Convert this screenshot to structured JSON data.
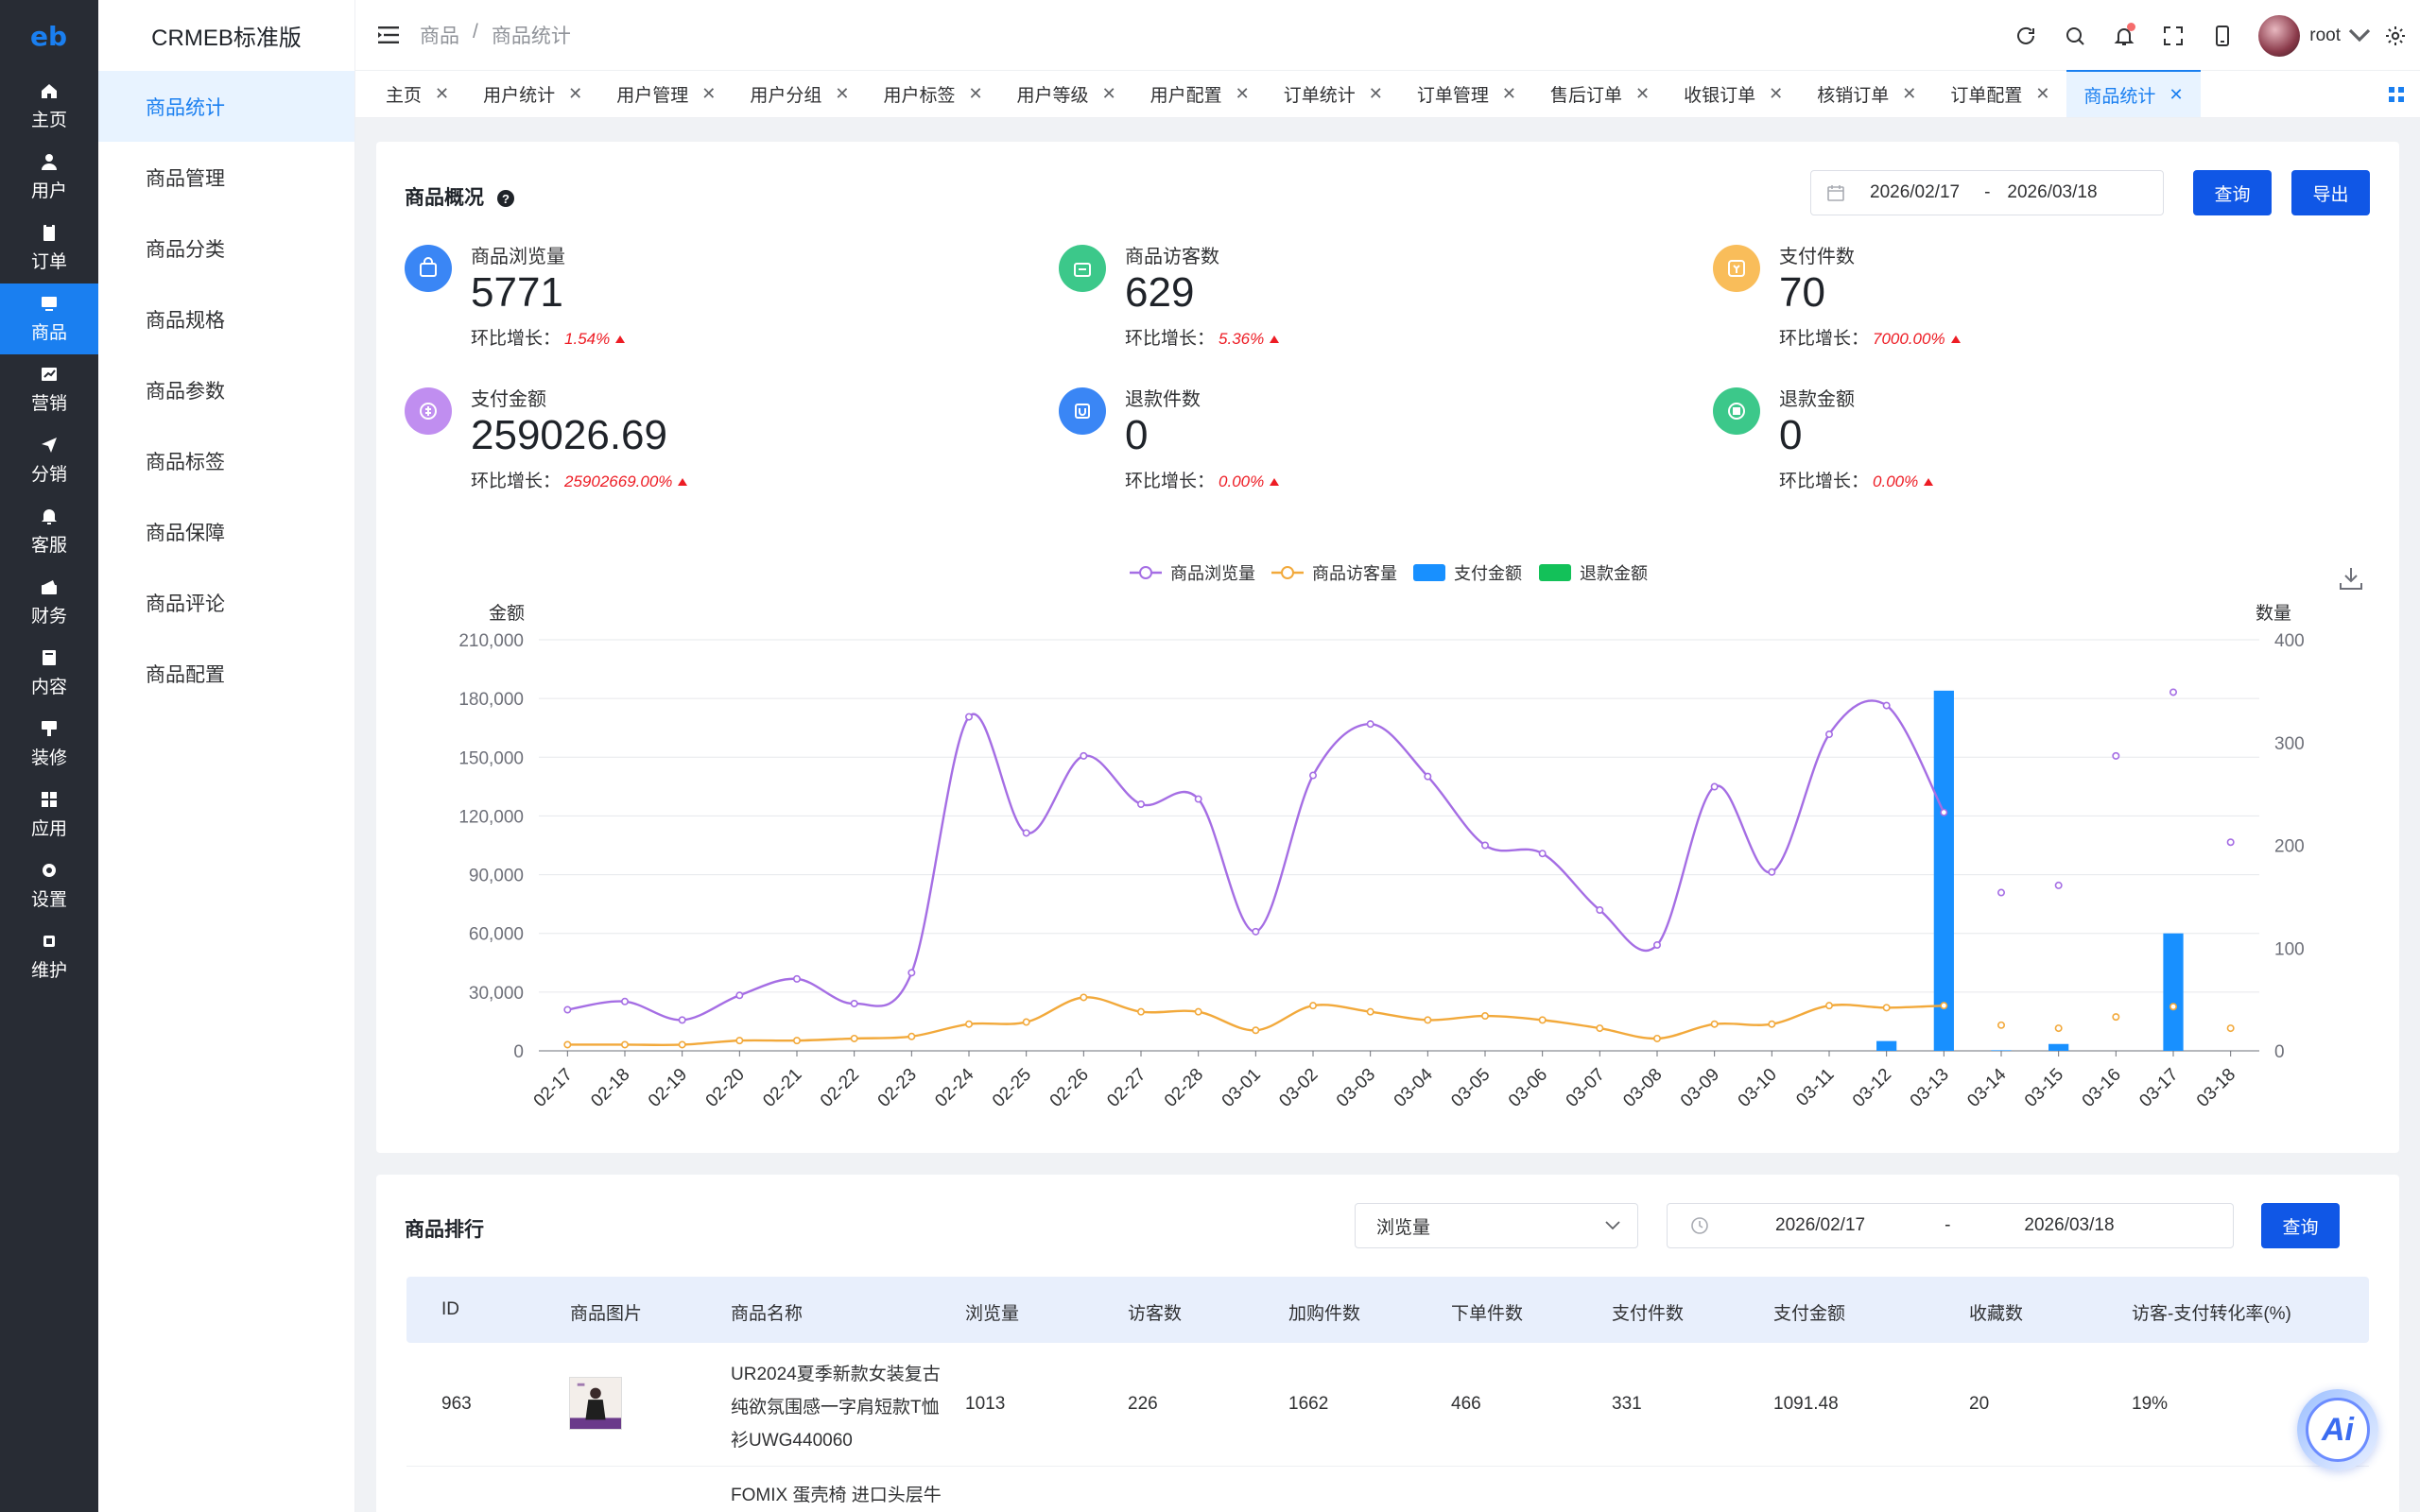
{
  "rail": {
    "logo": "eb",
    "items": [
      {
        "label": "主页",
        "icon": "home-icon"
      },
      {
        "label": "用户",
        "icon": "user-icon"
      },
      {
        "label": "订单",
        "icon": "order-icon"
      },
      {
        "label": "商品",
        "icon": "product-icon"
      },
      {
        "label": "营销",
        "icon": "marketing-icon"
      },
      {
        "label": "分销",
        "icon": "distribution-icon"
      },
      {
        "label": "客服",
        "icon": "service-icon"
      },
      {
        "label": "财务",
        "icon": "finance-icon"
      },
      {
        "label": "内容",
        "icon": "content-icon"
      },
      {
        "label": "装修",
        "icon": "decorate-icon"
      },
      {
        "label": "应用",
        "icon": "apps-icon"
      },
      {
        "label": "设置",
        "icon": "settings-icon"
      },
      {
        "label": "维护",
        "icon": "maintain-icon"
      }
    ],
    "active_index": 3
  },
  "submenu": {
    "brand": "CRMEB标准版",
    "items": [
      "商品统计",
      "商品管理",
      "商品分类",
      "商品规格",
      "商品参数",
      "商品标签",
      "商品保障",
      "商品评论",
      "商品配置"
    ],
    "active_index": 0
  },
  "header": {
    "breadcrumb": [
      "商品",
      "/",
      "商品统计"
    ],
    "username": "root"
  },
  "tabs": [
    "主页",
    "用户统计",
    "用户管理",
    "用户分组",
    "用户标签",
    "用户等级",
    "用户配置",
    "订单统计",
    "订单管理",
    "售后订单",
    "收银订单",
    "核销订单",
    "订单配置",
    "商品统计"
  ],
  "overview": {
    "title": "商品概况",
    "date_start": "2026/02/17",
    "date_sep": "-",
    "date_end": "2026/03/18",
    "query_label": "查询",
    "export_label": "导出",
    "change_label": "环比增长：",
    "stats": [
      {
        "label": "商品浏览量",
        "value": "5771",
        "change": "1.54%",
        "color": "#3a86f5",
        "icon": "browse-icon"
      },
      {
        "label": "商品访客数",
        "value": "629",
        "change": "5.36%",
        "color": "#3cc88a",
        "icon": "visitor-icon"
      },
      {
        "label": "支付件数",
        "value": "70",
        "change": "7000.00%",
        "color": "#f9bd5a",
        "icon": "paid-items-icon"
      },
      {
        "label": "支付金额",
        "value": "259026.69",
        "change": "25902669.00%",
        "color": "#c08ef0",
        "icon": "pay-amount-icon"
      },
      {
        "label": "退款件数",
        "value": "0",
        "change": "0.00%",
        "color": "#3a86f5",
        "icon": "refund-items-icon"
      },
      {
        "label": "退款金额",
        "value": "0",
        "change": "0.00%",
        "color": "#3cc88a",
        "icon": "refund-amount-icon"
      }
    ]
  },
  "chart_data": {
    "type": "line",
    "legend": [
      "商品浏览量",
      "商品访客量",
      "支付金额",
      "退款金额"
    ],
    "legend_position": "top-center",
    "left_axis_label": "金额",
    "right_axis_label": "数量",
    "left_ticks": [
      "0",
      "30,000",
      "60,000",
      "90,000",
      "120,000",
      "150,000",
      "180,000",
      "210,000"
    ],
    "right_ticks": [
      "0",
      "100",
      "200",
      "300",
      "400"
    ],
    "ylim_left": [
      0,
      210000
    ],
    "ylim_right": [
      0,
      400
    ],
    "categories": [
      "02-17",
      "02-18",
      "02-19",
      "02-20",
      "02-21",
      "02-22",
      "02-23",
      "02-24",
      "02-25",
      "02-26",
      "02-27",
      "02-28",
      "03-01",
      "03-02",
      "03-03",
      "03-04",
      "03-05",
      "03-06",
      "03-07",
      "03-08",
      "03-09",
      "03-10",
      "03-11",
      "03-12",
      "03-13",
      "03-14",
      "03-15",
      "03-16",
      "03-17",
      "03-18"
    ],
    "series": [
      {
        "name": "商品浏览量",
        "axis": "right",
        "kind": "line",
        "color": "#a56ee4",
        "values": [
          40,
          48,
          30,
          54,
          70,
          46,
          76,
          325,
          212,
          287,
          240,
          245,
          116,
          268,
          318,
          267,
          200,
          192,
          137,
          103,
          257,
          174,
          308,
          336,
          232,
          154,
          161,
          287,
          349,
          203
        ]
      },
      {
        "name": "商品访客量",
        "axis": "right",
        "kind": "line",
        "color": "#f2a93b",
        "values": [
          6,
          6,
          6,
          10,
          10,
          12,
          14,
          26,
          28,
          52,
          38,
          38,
          20,
          44,
          38,
          30,
          34,
          30,
          22,
          12,
          26,
          26,
          44,
          42,
          44,
          25,
          22,
          33,
          43,
          22
        ]
      },
      {
        "name": "支付金额",
        "axis": "left",
        "kind": "bar",
        "color": "#1890ff",
        "values": [
          0,
          0,
          0,
          0,
          0,
          0,
          0,
          0,
          0,
          0,
          0,
          0,
          0,
          0,
          0,
          0,
          0,
          0,
          0,
          0,
          0,
          0,
          0,
          5000,
          184000,
          300,
          3500,
          0,
          60000,
          0
        ]
      },
      {
        "name": "退款金额",
        "axis": "left",
        "kind": "bar",
        "color": "#13c159",
        "values": [
          0,
          0,
          0,
          0,
          0,
          0,
          0,
          0,
          0,
          0,
          0,
          0,
          0,
          0,
          0,
          0,
          0,
          0,
          0,
          0,
          0,
          0,
          0,
          0,
          0,
          0,
          0,
          0,
          0,
          0
        ]
      }
    ],
    "grid": true
  },
  "ranking": {
    "title": "商品排行",
    "select_value": "浏览量",
    "date_start": "2026/02/17",
    "date_sep": "-",
    "date_end": "2026/03/18",
    "query_label": "查询",
    "columns": [
      "ID",
      "商品图片",
      "商品名称",
      "浏览量",
      "访客数",
      "加购件数",
      "下单件数",
      "支付件数",
      "支付金额",
      "收藏数",
      "访客-支付转化率(%)"
    ],
    "rows": [
      {
        "id": "963",
        "name_lines": [
          "UR2024夏季新款女装复古",
          "纯欲氛围感一字肩短款T恤",
          "衫UWG440060"
        ],
        "views": "1013",
        "visitors": "226",
        "cart": "1662",
        "orders": "466",
        "paid": "331",
        "amount": "1091.48",
        "fav": "20",
        "rate": "19%"
      },
      {
        "name_lines": [
          "FOMIX 蛋壳椅 进口头层牛"
        ]
      }
    ]
  },
  "ai_button": "Ai"
}
